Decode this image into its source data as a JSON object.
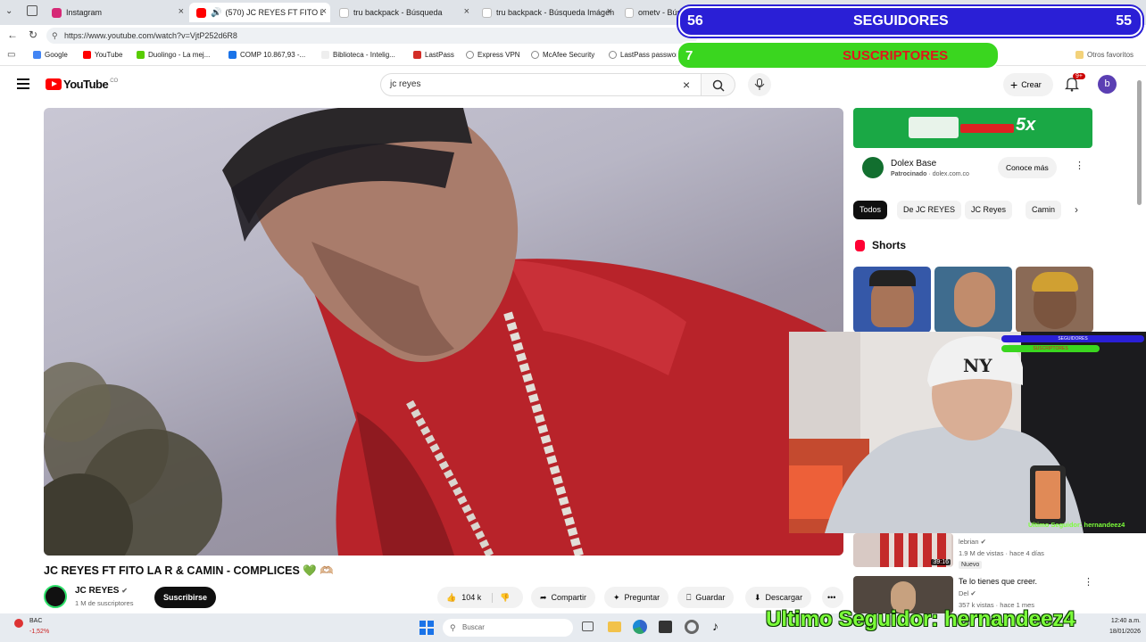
{
  "browser": {
    "tabs": [
      {
        "title": "Instagram",
        "color": "#d62976"
      },
      {
        "title": "(570) JC REYES FT FITO LA R &",
        "color": "#ff0000",
        "active": true
      },
      {
        "title": "tru backpack - Búsqueda",
        "color": "#4285f4"
      },
      {
        "title": "tru backpack - Búsqueda Imágen",
        "color": "#4285f4"
      },
      {
        "title": "ometv - Búsq",
        "color": "#4285f4"
      }
    ],
    "url": "https://www.youtube.com/watch?v=VjtP252d6R8",
    "bookmarks": [
      "Google",
      "YouTube",
      "Duolingo - La mej...",
      "COMP 10.867,93 -...",
      "Biblioteca - Intelig...",
      "LastPass",
      "Express VPN",
      "McAfee Security",
      "LastPass passwor..."
    ],
    "other_favorites": "Otros favoritos"
  },
  "youtube": {
    "logo": "YouTube",
    "country": "CO",
    "search_value": "jc reyes",
    "create_label": "Crear",
    "notif_count": "9+",
    "avatar_letter": "b",
    "video": {
      "title": "JC REYES FT FITO LA R & CAMIN - COMPLICES 💚 🫶🏼",
      "channel": "JC REYES",
      "subscribers": "1 M de suscriptores",
      "subscribe_label": "Suscribirse",
      "likes": "104 k",
      "share_label": "Compartir",
      "ask_label": "Preguntar",
      "save_label": "Guardar",
      "download_label": "Descargar"
    },
    "ad": {
      "name": "Dolex Base",
      "sponsored": "Patrocinado",
      "domain": "dolex.com.co",
      "cta": "Conoce más",
      "banner_text": "5x"
    },
    "chips": [
      "Todos",
      "De JC REYES",
      "JC Reyes",
      "Camin"
    ],
    "shorts_label": "Shorts",
    "related": [
      {
        "title": "",
        "channel": "lebrian",
        "meta": "1.9 M de vistas · hace 4 días",
        "badge": "Nuevo",
        "duration": "39:16"
      },
      {
        "title": "Te lo tienes que creer.",
        "channel": "Del",
        "meta": "357 k vistas · hace 1 mes",
        "badge": "",
        "duration": ""
      }
    ]
  },
  "overlay": {
    "followers_left": "56",
    "followers_label": "SEGUIDORES",
    "followers_right": "55",
    "subs_left": "7",
    "subs_label": "SUSCRIPTORES",
    "mini_followers_label": "SEGUIDORES",
    "mini_subs_label": "SUSCRIPTORES",
    "webcam_caption": "Ultimo Seguidor: hernandeez4",
    "last_follower": "Ultimo Seguidor: hernandeez4",
    "cap_text": "NY"
  },
  "taskbar": {
    "weather_label": "BAC",
    "weather_value": "-1,52%",
    "search_placeholder": "Buscar",
    "time": "12:40 a.m.",
    "date": "18/01/2026"
  },
  "colors": {
    "followers_bar": "#2a1fd6",
    "subs_bar": "#3ad61f",
    "accent_red": "#ff0000"
  }
}
